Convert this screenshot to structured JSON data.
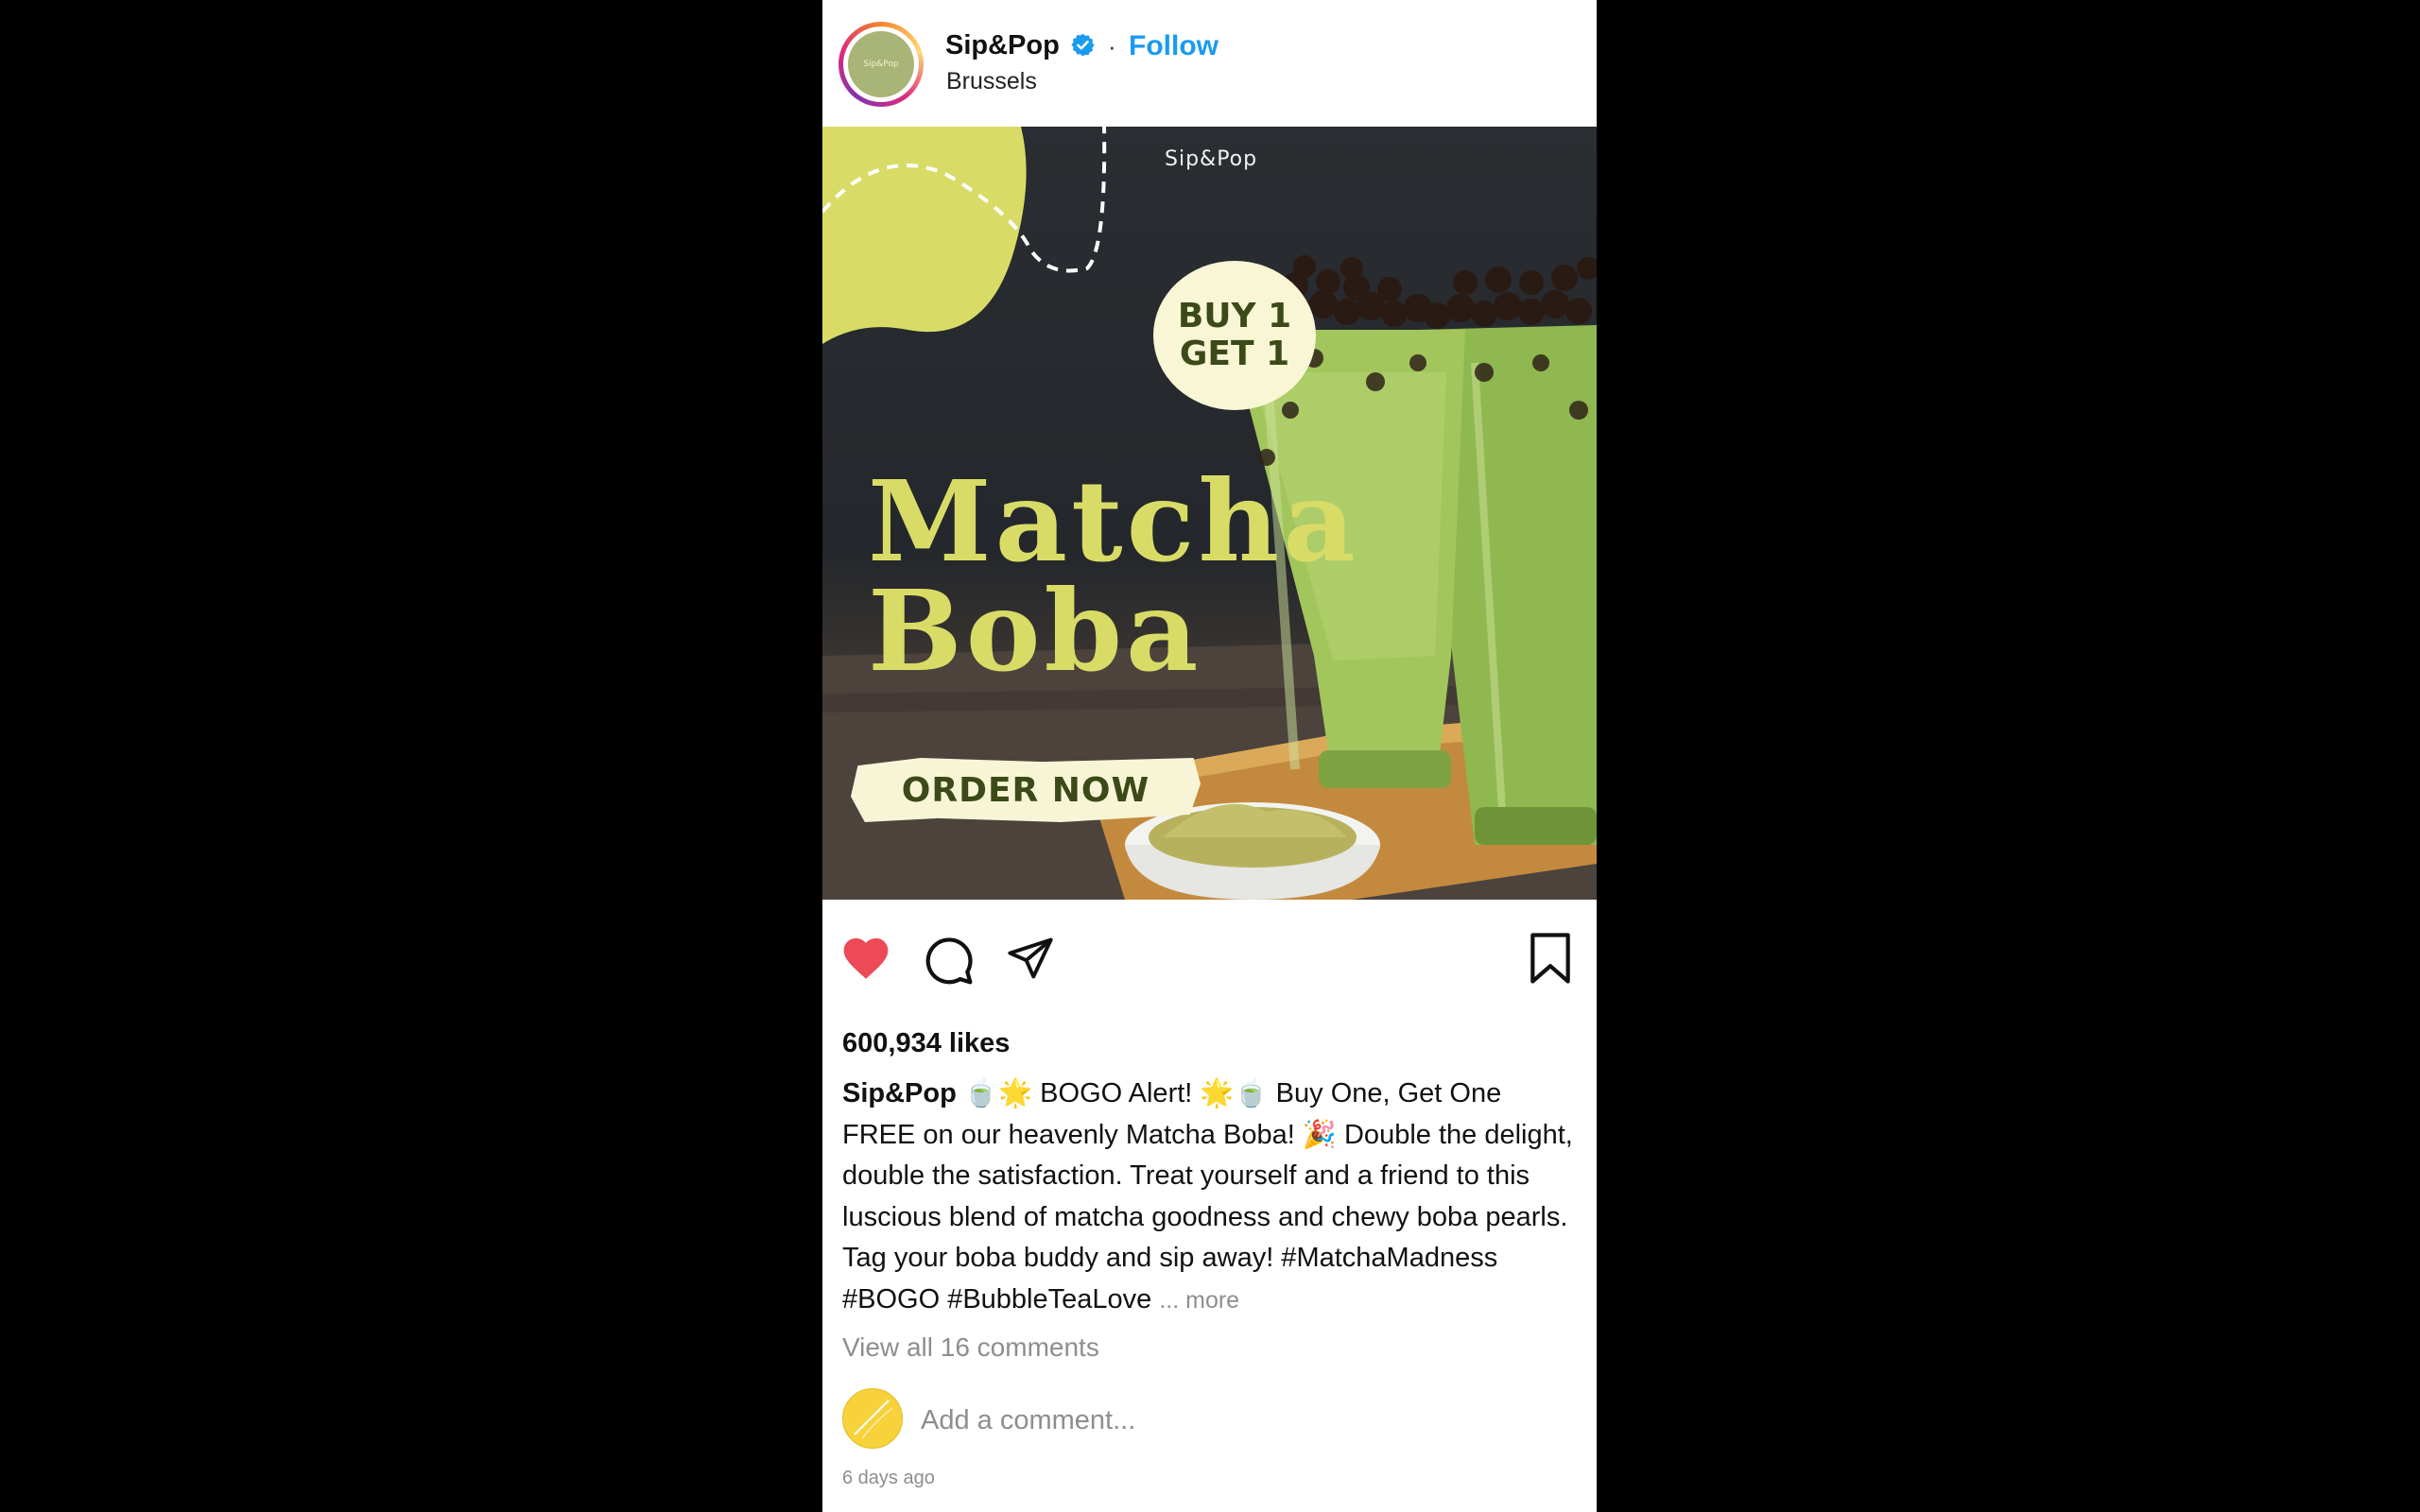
{
  "header": {
    "username": "Sip&Pop",
    "follow_label": "Follow",
    "separator": "·",
    "location": "Brussels",
    "avatar_text": "Sip&Pop"
  },
  "photo": {
    "brand": "Sip&Pop",
    "bogo_line1": "BUY 1",
    "bogo_line2": "GET 1",
    "headline_line1": "Matcha",
    "headline_line2": "Boba",
    "cta": "ORDER NOW"
  },
  "actions": {
    "liked": true,
    "like_color": "#ed4956"
  },
  "likes": "600,934 likes",
  "caption": {
    "username": "Sip&Pop",
    "text": "🍵🌟 BOGO Alert! 🌟🍵 Buy One, Get One FREE on our heavenly Matcha Boba! 🎉 Double the delight, double the satisfaction. Treat yourself and a friend to this luscious blend of matcha goodness and chewy boba pearls. Tag your boba buddy and sip away! #MatchaMadness #BOGO #BubbleTeaLove",
    "more_label": "... more"
  },
  "comments": {
    "view_all": "View all 16 comments",
    "placeholder": "Add a comment..."
  },
  "timestamp": "6 days ago",
  "colors": {
    "follow": "#1a9bf0",
    "verified": "#1a9bf0",
    "headline": "#d8dc67",
    "cta_text": "#3b4a18"
  }
}
